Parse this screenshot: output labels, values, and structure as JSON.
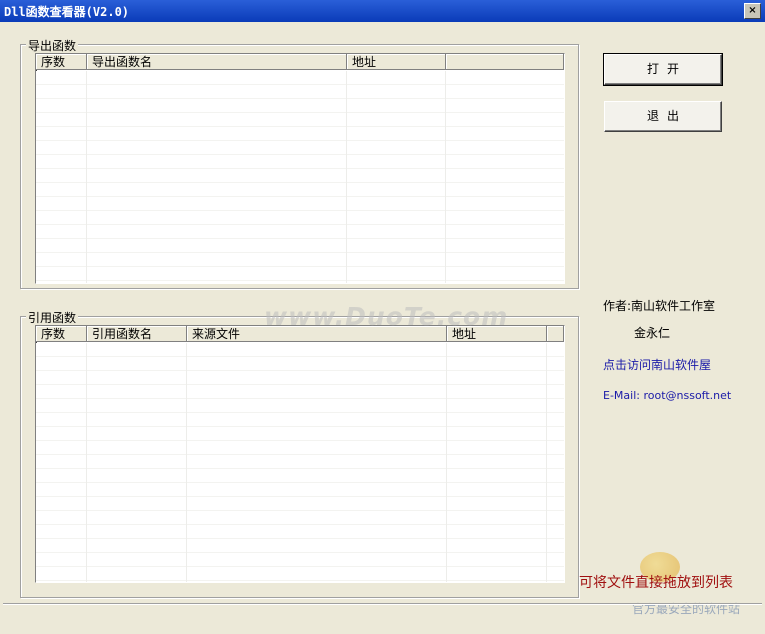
{
  "window": {
    "title": "Dll函数查看器(V2.0)",
    "close_label": "×"
  },
  "export_group": {
    "label": "导出函数",
    "columns": [
      "序数",
      "导出函数名",
      "地址",
      ""
    ]
  },
  "import_group": {
    "label": "引用函数",
    "columns": [
      "序数",
      "引用函数名",
      "来源文件",
      "地址",
      ""
    ]
  },
  "buttons": {
    "open": "打开",
    "exit": "退出"
  },
  "info": {
    "author_label": "作者:南山软件工作室",
    "author_name": "金永仁",
    "visit_link": "点击访问南山软件屋",
    "email": "E-Mail: root@nssoft.net"
  },
  "hint": "可将文件直接拖放到列表",
  "watermarks": {
    "center": "www.DuoTe.com",
    "corner": "官方最安全的软件站"
  },
  "colors": {
    "title_bar": "#0a3bb8",
    "link": "#1a1aa8",
    "hint": "#a01010",
    "window_bg": "#ece9d8"
  }
}
